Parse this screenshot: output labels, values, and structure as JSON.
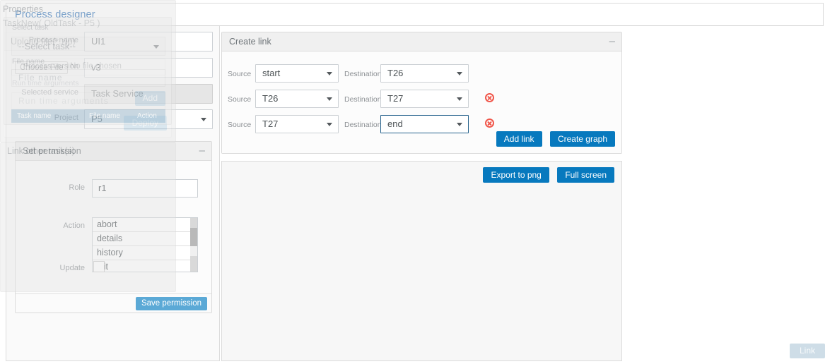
{
  "header": {
    "title": "Process designer"
  },
  "process_form": {
    "fields": [
      {
        "label": "Process name",
        "value": "UI1",
        "type": "text",
        "readonly": false
      },
      {
        "label": "Process version",
        "value": "v3",
        "type": "text",
        "readonly": false
      },
      {
        "label": "Selected service",
        "value": "Task Service",
        "type": "text",
        "readonly": true
      },
      {
        "label": "Project",
        "value": "P5",
        "type": "select",
        "readonly": false
      }
    ]
  },
  "set_permission": {
    "title": "Set permission",
    "collapse_glyph": "–",
    "role_label": "Role",
    "role_value": "r1",
    "action_label": "Action",
    "action_options": [
      "abort",
      "details",
      "history",
      "init"
    ],
    "update_label": "Update",
    "update_checked": false,
    "save_label": "Save permission"
  },
  "create_link": {
    "title": "Create link",
    "collapse_glyph": "–",
    "source_label": "Source",
    "destination_label": "Destination",
    "rows": [
      {
        "source": "start",
        "destination": "T26",
        "removable": false,
        "dest_focused": false
      },
      {
        "source": "T26",
        "destination": "T27",
        "removable": true,
        "dest_focused": false
      },
      {
        "source": "T27",
        "destination": "end",
        "removable": true,
        "dest_focused": true
      }
    ],
    "add_link_label": "Add link",
    "create_graph_label": "Create graph"
  },
  "graph_area": {
    "export_label": "Export to png",
    "fullscreen_label": "Full screen"
  },
  "properties": {
    "title": "Properties",
    "subtitle": "TaskNew( OldTask - P5 )",
    "upload": {
      "title": "Upload file(*.zip)",
      "choose_file_label": "Choose File",
      "file_status": "No file chosen",
      "runtime_args_label": "Run time arguments",
      "runtime_args_placeholder": "Run time arguments",
      "runtime_args_value": "",
      "deploy_label": "Deploy"
    }
  },
  "link_other_tasks": {
    "title": "Link other task(s)",
    "select_task_label": "Select task",
    "select_task_value": "--Select task--",
    "file_name_label": "File name",
    "file_name_placeholder": "File name",
    "file_name_value": "",
    "add_label": "Add",
    "table_headers": [
      "Task name",
      "File name",
      "Action"
    ],
    "link_label": "Link"
  },
  "colors": {
    "accent_blue": "#2e72b8",
    "primary_button": "#0779be",
    "light_button": "#5ba9d6",
    "disabled_button": "#a9c7da",
    "table_header": "#8aafc6",
    "remove_icon": "#f0564a",
    "focus_border": "#26628c"
  }
}
